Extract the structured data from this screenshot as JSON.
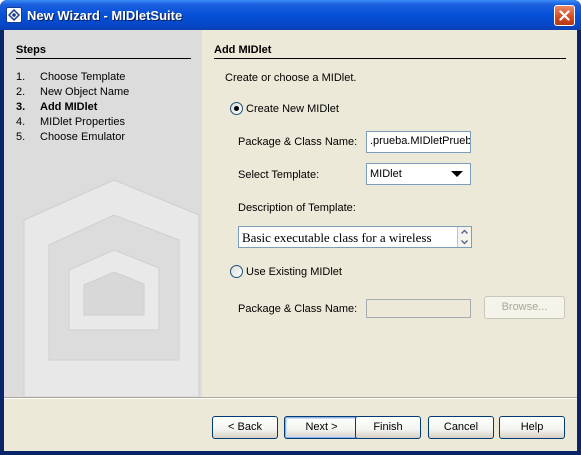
{
  "window": {
    "title": "New Wizard - MIDletSuite"
  },
  "steps": {
    "title": "Steps",
    "items": [
      {
        "num": "1.",
        "label": "Choose Template"
      },
      {
        "num": "2.",
        "label": "New Object Name"
      },
      {
        "num": "3.",
        "label": "Add MIDlet"
      },
      {
        "num": "4.",
        "label": "MIDlet Properties"
      },
      {
        "num": "5.",
        "label": "Choose Emulator"
      }
    ],
    "current": 3
  },
  "panel": {
    "title": "Add MIDlet",
    "intro": "Create or choose a MIDlet.",
    "create_new": {
      "label": "Create New MIDlet",
      "checked": true
    },
    "package_class": {
      "label": "Package & Class Name:",
      "value": ".prueba.MIDletPrueba"
    },
    "select_template": {
      "label": "Select Template:",
      "value": "MIDlet"
    },
    "description": {
      "label": "Description of Template:",
      "text": "Basic executable class for a wireless"
    },
    "use_existing": {
      "label": "Use Existing MIDlet",
      "checked": false
    },
    "existing_package_class": {
      "label": "Package & Class Name:",
      "value": ""
    },
    "browse": "Browse..."
  },
  "buttons": {
    "back": "< Back",
    "next": "Next >",
    "finish": "Finish",
    "cancel": "Cancel",
    "help": "Help"
  },
  "colors": {
    "titlebar": "#0550d6",
    "close": "#d14a22",
    "dialog_bg": "#ece9d8",
    "border": "#7f9db9"
  }
}
